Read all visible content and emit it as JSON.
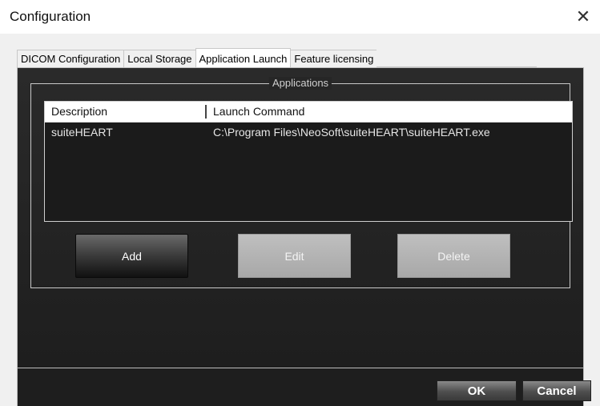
{
  "window": {
    "title": "Configuration",
    "close_symbol": "✕"
  },
  "tabs": [
    {
      "label": "DICOM Configuration",
      "active": false
    },
    {
      "label": "Local Storage",
      "active": false
    },
    {
      "label": "Application Launch",
      "active": true
    },
    {
      "label": "Feature licensing",
      "active": false
    }
  ],
  "applications": {
    "group_title": "Applications",
    "columns": [
      "Description",
      "Launch Command"
    ],
    "rows": [
      {
        "description": "suiteHEART",
        "command": "C:\\Program Files\\NeoSoft\\suiteHEART\\suiteHEART.exe"
      }
    ],
    "buttons": {
      "add": "Add",
      "edit": "Edit",
      "delete": "Delete"
    }
  },
  "footer": {
    "ok": "OK",
    "cancel": "Cancel"
  }
}
